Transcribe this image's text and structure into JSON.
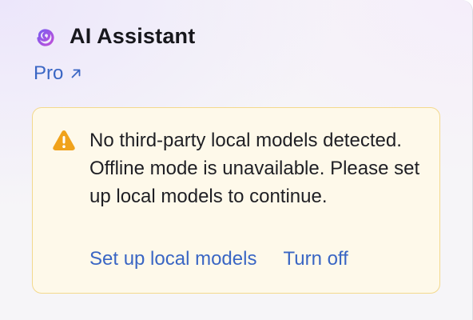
{
  "header": {
    "logo_icon": "ai-assistant-spiral-icon",
    "title": "AI Assistant"
  },
  "plan": {
    "label": "Pro",
    "icon": "external-arrow-icon"
  },
  "warning": {
    "icon": "warning-triangle-icon",
    "message": "No third-party local models detected. Offline mode is unavailable. Please set up local models to continue.",
    "actions": {
      "setup_label": "Set up local models",
      "turn_off_label": "Turn off"
    }
  },
  "colors": {
    "accent_link": "#3a66c4",
    "logo_gradient_start": "#7b5cf0",
    "logo_gradient_end": "#c04fd8",
    "warning_icon": "#f0a21b",
    "warning_bg": "#fef9ea",
    "warning_border": "#f3d98d"
  }
}
